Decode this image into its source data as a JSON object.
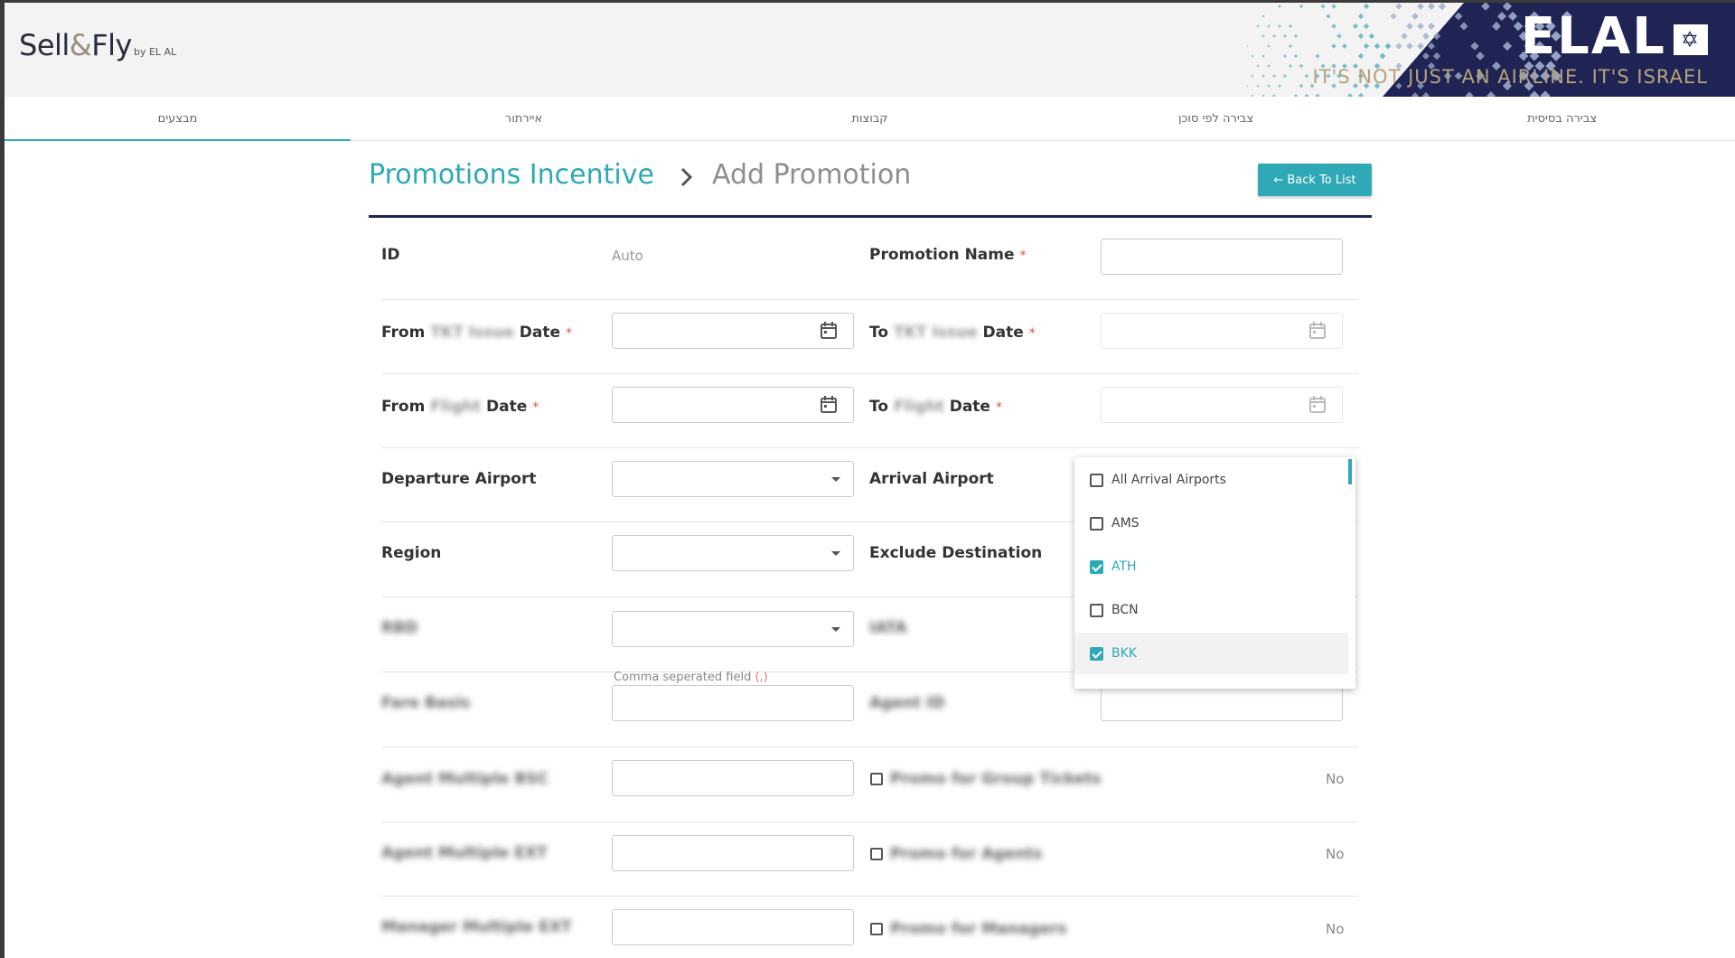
{
  "header": {
    "logo_sell": "Sell",
    "logo_amp": "&",
    "logo_fly": "Fly",
    "logo_by": "by EL AL",
    "brand": "ELAL",
    "brand_tagline": "IT'S NOT JUST AN AIRLINE. IT'S ISRAEL"
  },
  "tabs": [
    {
      "label": "צבירה בסיסית",
      "active": false
    },
    {
      "label": "צבירה לפי סוכן",
      "active": false
    },
    {
      "label": "קבוצות",
      "active": false
    },
    {
      "label": "איירתור",
      "active": false
    },
    {
      "label": "מבצעים",
      "active": true
    }
  ],
  "breadcrumb": {
    "root": "Promotions Incentive",
    "current": "Add Promotion"
  },
  "back_button": "← Back To List",
  "form": {
    "id_label": "ID",
    "id_value": "Auto",
    "promo_name_label": "Promotion Name",
    "from_issue_prefix": "From",
    "from_issue_blur": "TKT Issue",
    "date_word": "Date",
    "to_prefix": "To",
    "from_flight_prefix": "From",
    "flight_blur": "Flight",
    "departure_label": "Departure Airport",
    "arrival_label": "Arrival Airport",
    "region_label": "Region",
    "exclude_label": "Exclude Destination",
    "rbd_label": "RBD",
    "iata_label": "IATA",
    "comma_hint": "Comma seperated field",
    "comma_hint_paren": "(,)",
    "fare_basis_label": "Fare Basis",
    "agent_id_label": "Agent ID",
    "agent_multiple_bsc_label": "Agent Multiple BSC",
    "promo_group_label": "Promo for Group Tickets",
    "promo_group_value": "No",
    "agent_multiple_ext_label": "Agent Multiple EXT",
    "promo_agents_label": "Promo for Agents",
    "promo_agents_value": "No",
    "manager_multiple_ext_label": "Manager Multiple EXT",
    "promo_managers_label": "Promo for Managers",
    "promo_managers_value": "No",
    "required_mark": "*"
  },
  "arrival_dropdown": {
    "options": [
      {
        "label": "All Arrival Airports",
        "checked": false
      },
      {
        "label": "AMS",
        "checked": false
      },
      {
        "label": "ATH",
        "checked": true
      },
      {
        "label": "BCN",
        "checked": false
      },
      {
        "label": "BKK",
        "checked": true
      }
    ]
  },
  "colors": {
    "accent": "#2ea9b5",
    "navy": "#1f2454",
    "gold": "#b6a37a"
  }
}
